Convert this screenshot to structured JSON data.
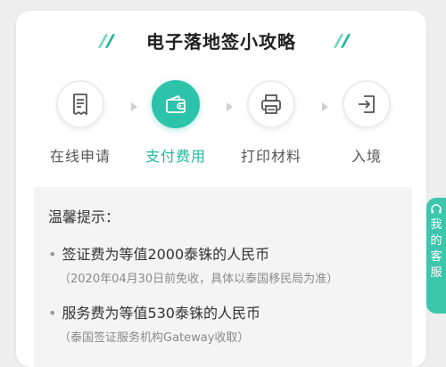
{
  "title": "电子落地签小攻略",
  "steps": [
    {
      "label": "在线申请",
      "icon": "document-icon"
    },
    {
      "label": "支付费用",
      "icon": "wallet-icon"
    },
    {
      "label": "打印材料",
      "icon": "printer-icon"
    },
    {
      "label": "入境",
      "icon": "entry-icon"
    }
  ],
  "active_step": 1,
  "tips": {
    "title": "温馨提示：",
    "bullet": "•",
    "items": [
      {
        "main": "签证费为等值2000泰铢的人民币",
        "note": "（2020年04月30日前免收，具体以泰国移民局为准）"
      },
      {
        "main": "服务费为等值530泰铢的人民币",
        "note": "（泰国签证服务机构Gateway收取）"
      }
    ]
  },
  "customer_service": {
    "label": "我的客服"
  },
  "colors": {
    "accent": "#2dc3aa",
    "accent_dark": "#1fb89f",
    "bg": "#eeeeef"
  }
}
